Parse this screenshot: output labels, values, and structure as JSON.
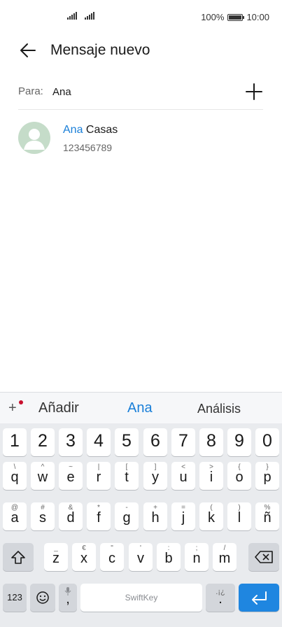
{
  "status": {
    "battery": "100%",
    "time": "10:00",
    "battery_level": 1.0
  },
  "header": {
    "title": "Mensaje nuevo",
    "back_icon": "back-arrow-icon"
  },
  "recipient": {
    "label": "Para:",
    "value": "Ana",
    "add_icon": "plus-icon"
  },
  "suggestion": {
    "highlight": "Ana",
    "rest": " Casas",
    "number": "123456789",
    "avatar_icon": "person-avatar-icon",
    "avatar_color": "#c5dcc9"
  },
  "colors": {
    "accent": "#1a7fd8",
    "enter": "#1f86e0"
  },
  "keyboard": {
    "suggestions": [
      "Añadir",
      "Ana",
      "Análisis"
    ],
    "tool_label": "+",
    "numbers": [
      "1",
      "2",
      "3",
      "4",
      "5",
      "6",
      "7",
      "8",
      "9",
      "0"
    ],
    "row1": [
      {
        "main": "q",
        "sub": "\\"
      },
      {
        "main": "w",
        "sub": "^"
      },
      {
        "main": "e",
        "sub": "~"
      },
      {
        "main": "r",
        "sub": "|"
      },
      {
        "main": "t",
        "sub": "["
      },
      {
        "main": "y",
        "sub": "]"
      },
      {
        "main": "u",
        "sub": "<"
      },
      {
        "main": "i",
        "sub": ">"
      },
      {
        "main": "o",
        "sub": "{"
      },
      {
        "main": "p",
        "sub": "}"
      }
    ],
    "row2": [
      {
        "main": "a",
        "sub": "@"
      },
      {
        "main": "s",
        "sub": "#"
      },
      {
        "main": "d",
        "sub": "&"
      },
      {
        "main": "f",
        "sub": "*"
      },
      {
        "main": "g",
        "sub": "-"
      },
      {
        "main": "h",
        "sub": "+"
      },
      {
        "main": "j",
        "sub": "="
      },
      {
        "main": "k",
        "sub": "("
      },
      {
        "main": "l",
        "sub": ")"
      },
      {
        "main": "ñ",
        "sub": "%"
      }
    ],
    "row3": [
      {
        "main": "z",
        "sub": "_"
      },
      {
        "main": "x",
        "sub": "€"
      },
      {
        "main": "c",
        "sub": "\""
      },
      {
        "main": "v",
        "sub": "'"
      },
      {
        "main": "b",
        "sub": ":"
      },
      {
        "main": "n",
        "sub": ";"
      },
      {
        "main": "m",
        "sub": "/"
      }
    ],
    "sym_label": "123",
    "comma": ",",
    "period": ".",
    "period_sub": ".¡¿",
    "space_label": "SwiftKey",
    "icons": {
      "shift": "shift-icon",
      "backspace": "backspace-icon",
      "emoji": "emoji-icon",
      "mic": "microphone-icon",
      "enter": "enter-icon"
    }
  }
}
